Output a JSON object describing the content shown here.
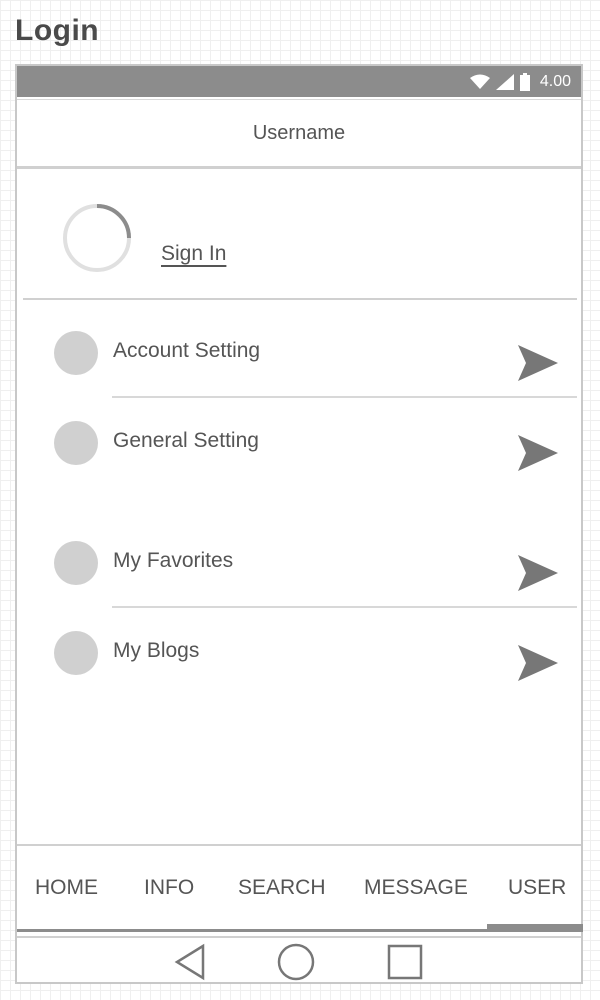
{
  "page": {
    "title": "Login"
  },
  "status_bar": {
    "time": "4.00",
    "icons": [
      "wifi-icon",
      "signal-icon",
      "battery-icon"
    ]
  },
  "header": {
    "username": "Username"
  },
  "auth": {
    "signin_label": "Sign In"
  },
  "menu": [
    {
      "label": "Account Setting",
      "icon": "circle-icon",
      "action_icon": "send-arrow-icon"
    },
    {
      "label": "General Setting",
      "icon": "circle-icon",
      "action_icon": "send-arrow-icon"
    },
    {
      "label": "My Favorites",
      "icon": "circle-icon",
      "action_icon": "send-arrow-icon"
    },
    {
      "label": "My Blogs",
      "icon": "circle-icon",
      "action_icon": "send-arrow-icon"
    }
  ],
  "tabs": [
    {
      "label": "HOME"
    },
    {
      "label": "INFO"
    },
    {
      "label": "SEARCH"
    },
    {
      "label": "MESSAGE"
    },
    {
      "label": "USER",
      "active": true
    }
  ],
  "nav_bar": {
    "icons": [
      "back-triangle-icon",
      "home-circle-icon",
      "recents-square-icon"
    ]
  },
  "colors": {
    "accent": "#8c8c8c",
    "placeholder": "#d0d0d0",
    "text": "#555555"
  }
}
